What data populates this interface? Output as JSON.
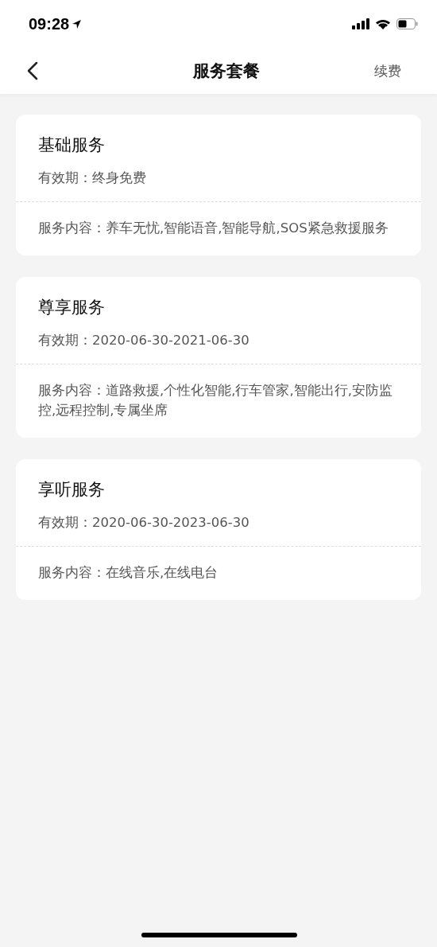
{
  "status_bar": {
    "time": "09:28"
  },
  "nav": {
    "title": "服务套餐",
    "action": "续费"
  },
  "cards": [
    {
      "title": "基础服务",
      "validity": "有效期：终身免费",
      "content": "服务内容：养车无忧,智能语音,智能导航,SOS紧急救援服务"
    },
    {
      "title": "尊享服务",
      "validity": "有效期：2020-06-30-2021-06-30",
      "content": "服务内容：道路救援,个性化智能,行车管家,智能出行,安防监控,远程控制,专属坐席"
    },
    {
      "title": "享听服务",
      "validity": "有效期：2020-06-30-2023-06-30",
      "content": "服务内容：在线音乐,在线电台"
    }
  ]
}
